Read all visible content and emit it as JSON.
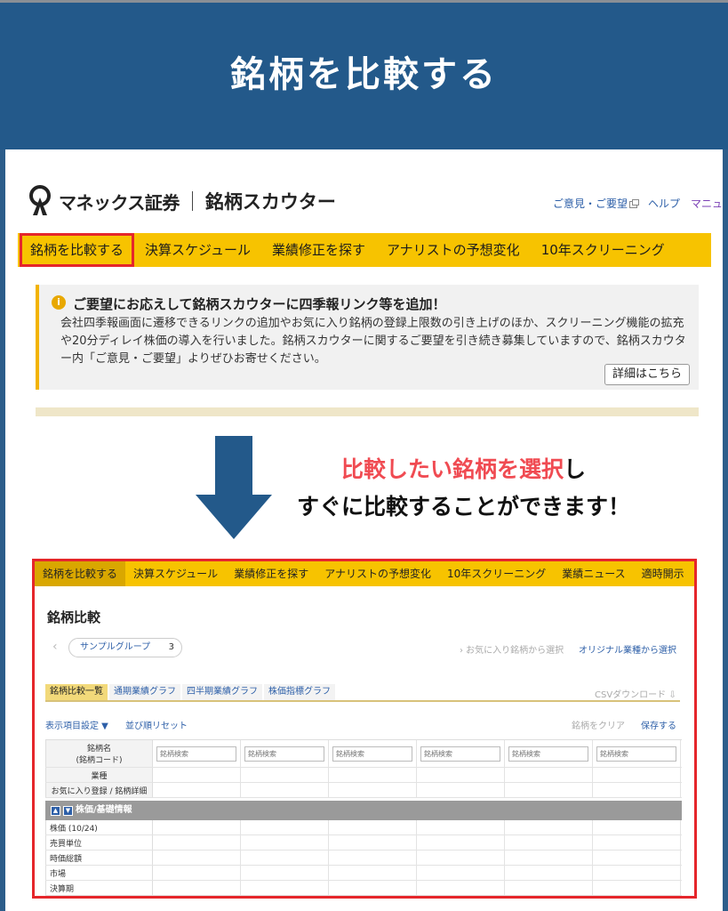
{
  "banner": {
    "title": "銘柄を比較する"
  },
  "header": {
    "brand": "マネックス証券",
    "product": "銘柄スカウター",
    "links": [
      "ご意見・ご要望",
      "ヘルプ",
      "マニュ"
    ]
  },
  "topnav": [
    "銘柄を比較する",
    "決算スケジュール",
    "業績修正を探す",
    "アナリストの予想変化",
    "10年スクリーニング"
  ],
  "notice": {
    "title": "ご要望にお応えして銘柄スカウターに四季報リンク等を追加！",
    "body": "会社四季報画面に遷移できるリンクの追加やお気に入り銘柄の登録上限数の引き上げのほか、スクリーニング機能の拡充や20分ディレイ株価の導入を行いました。銘柄スカウターに関するご要望を引き続き募集していますので、銘柄スカウター内「ご意見・ご要望」よりぜひお寄せください。",
    "button": "詳細はこちら"
  },
  "caption": {
    "line1_red": "比較したい銘柄を選択",
    "line1_black": "し",
    "line2": "すぐに比較することができます！"
  },
  "screenshot": {
    "nav": [
      "銘柄を比較する",
      "決算スケジュール",
      "業績修正を探す",
      "アナリストの予想変化",
      "10年スクリーニング",
      "業績ニュース",
      "適時開示"
    ],
    "title": "銘柄比較",
    "group_label": "サンプルグループ",
    "group_count": "3",
    "fav_select": "› お気に入り銘柄から選択",
    "original_select": "オリジナル業種から選択",
    "tabs": [
      "銘柄比較一覧",
      "通期業績グラフ",
      "四半期業績グラフ",
      "株価指標グラフ"
    ],
    "csv": "CSVダウンロード ⇩",
    "display_settings": "表示項目設定 ▼",
    "sort_reset": "並び順リセット",
    "clear": "銘柄をクリア",
    "save": "保存する",
    "name_label": "銘柄名",
    "code_label": "(銘柄コード)",
    "search_placeholder": "銘柄検索",
    "industry_label": "業種",
    "fav_label": "お気に入り登録 / 銘柄詳細",
    "section": "株価/基礎情報",
    "rows": [
      "株価 (10/24)",
      "売買単位",
      "時価総額",
      "市場",
      "決算期"
    ]
  }
}
